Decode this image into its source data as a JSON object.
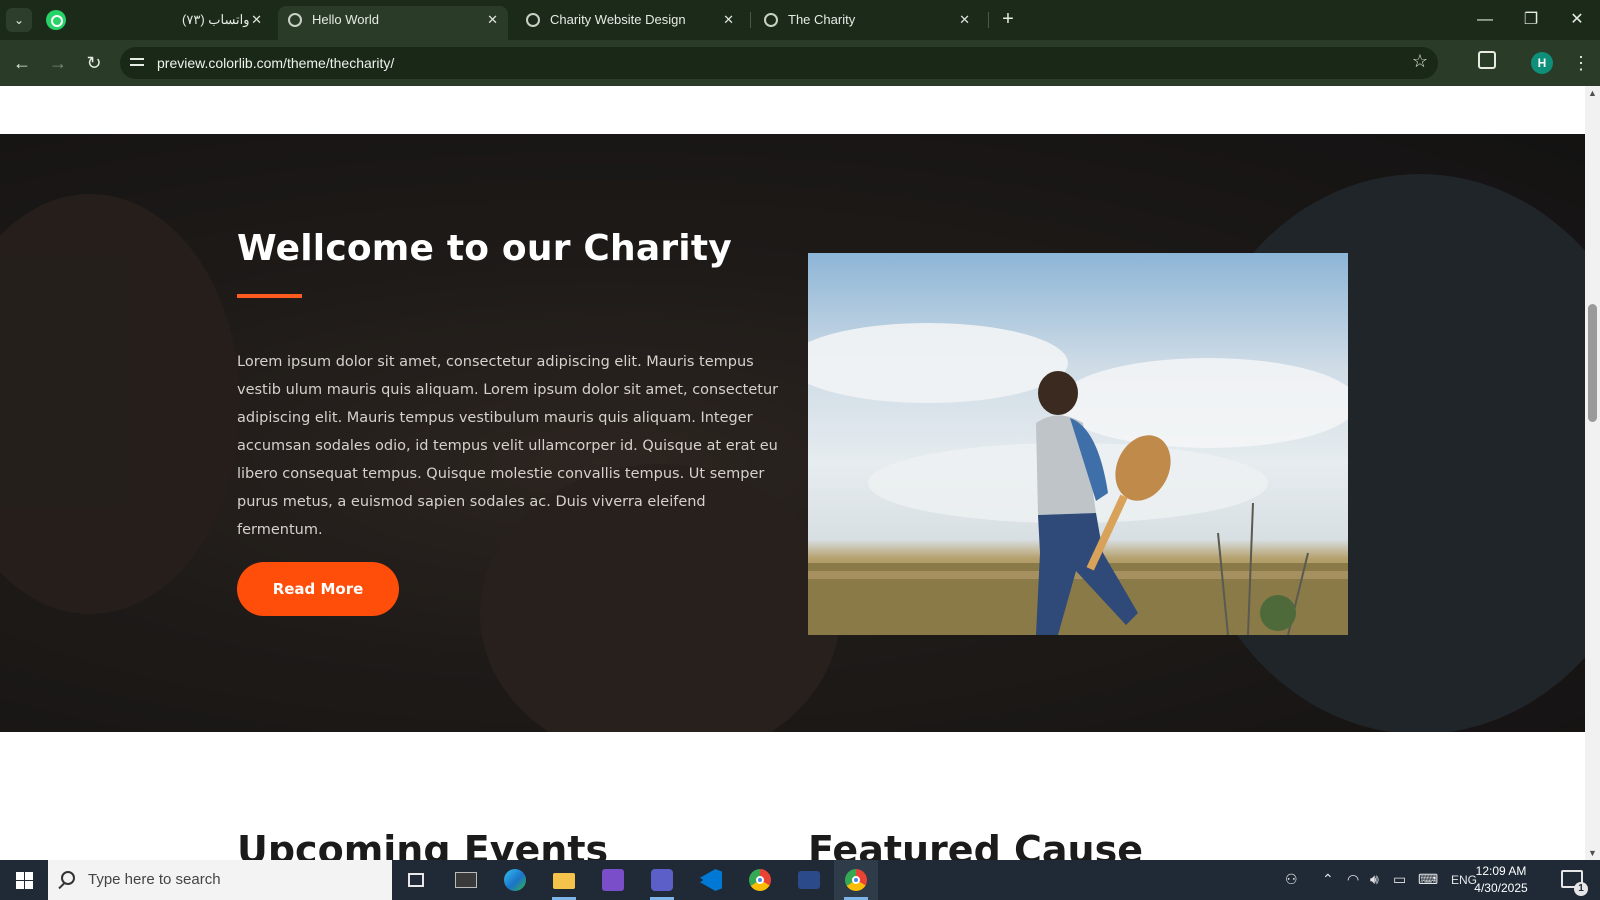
{
  "browser": {
    "tabs": [
      {
        "label": "واتساب (٧٣)",
        "icon": "whatsapp-icon",
        "active": false
      },
      {
        "label": "Hello World",
        "icon": "globe-icon",
        "active": true
      },
      {
        "label": "Charity Website Design",
        "icon": "chatgpt-icon",
        "active": false
      },
      {
        "label": "The Charity",
        "icon": "globe-icon",
        "active": false
      }
    ],
    "close_glyph": "✕",
    "new_tab_glyph": "+",
    "url": "preview.colorlib.com/theme/thecharity/",
    "profile_initial": "H",
    "window_controls": {
      "minimize": "—",
      "restore": "❐",
      "close": "✕"
    },
    "nav": {
      "back": "←",
      "forward": "→",
      "reload": "↻"
    },
    "colors": {
      "frame": "#1c2a1a",
      "toolbar": "#2a3b28"
    }
  },
  "page": {
    "hero": {
      "title": "Wellcome to our Charity",
      "body": "Lorem ipsum dolor sit amet, consectetur adipiscing elit. Mauris tempus vestib ulum mauris quis aliquam. Lorem ipsum dolor sit amet, consectetur adipiscing elit. Mauris tempus vestibulum mauris quis aliquam. Integer accumsan sodales odio, id tempus velit ullamcorper id. Quisque at erat eu libero consequat tempus. Quisque molestie convallis tempus. Ut semper purus metus, a euismod sapien sodales ac. Duis viverra eleifend fermentum.",
      "button_label": "Read More",
      "accent": "#ff4d0a"
    },
    "sections": {
      "events_title": "Upcoming Events",
      "cause_title": "Featured Cause"
    }
  },
  "taskbar": {
    "search_placeholder": "Type here to search",
    "language": "ENG",
    "time": "12:09 AM",
    "date": "4/30/2025",
    "notification_count": "1",
    "apps": [
      "task-view-icon",
      "terminal-icon",
      "edge-icon",
      "file-explorer-icon",
      "visual-studio-icon",
      "teams-icon",
      "vscode-icon",
      "chrome-icon",
      "app-icon",
      "chrome-profile-icon"
    ]
  }
}
